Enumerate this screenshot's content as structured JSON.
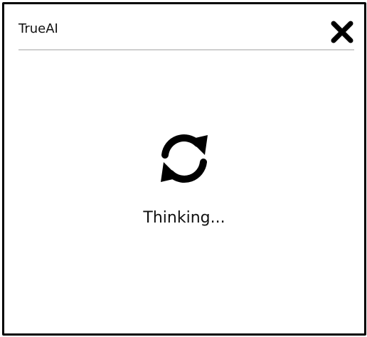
{
  "dialog": {
    "title": "TrueAI",
    "close_icon": "close-x-icon",
    "loading_icon": "refresh-sync-icon",
    "status_text": "Thinking..."
  }
}
